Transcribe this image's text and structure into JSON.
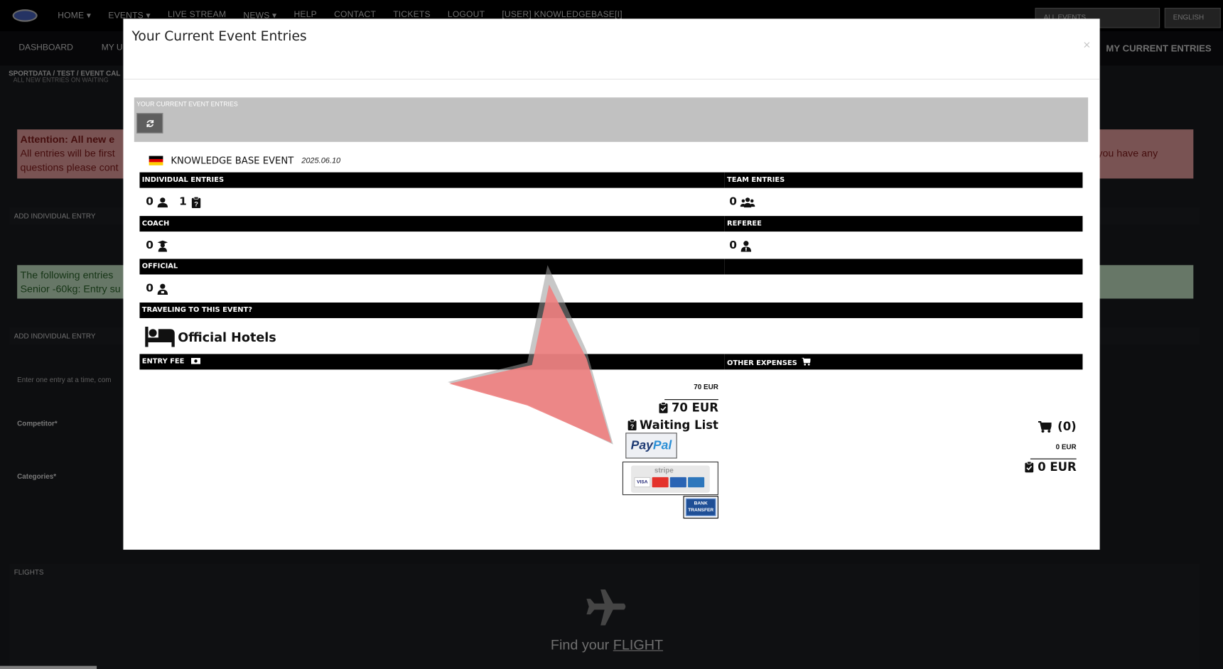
{
  "topnav": {
    "items": [
      "HOME ▾",
      "EVENTS ▾",
      "LIVE STREAM",
      "NEWS ▾",
      "HELP",
      "CONTACT",
      "TICKETS",
      "LOGOUT",
      "[USER] KNOWLEDGEBASE[I]"
    ],
    "events_select": "ALL EVENTS",
    "language_select": "ENGLISH"
  },
  "secnav": {
    "dashboard": "DASHBOARD",
    "my_u": "MY U",
    "my_current_entries": "MY CURRENT ENTRIES"
  },
  "breadcrumb": {
    "path": "SPORTDATA /  TEST /  EVENT CAL",
    "sub": "ALL NEW ENTRIES ON WAITING"
  },
  "background": {
    "alert_title": "Attention: All new e",
    "alert_text_1": "All entries will be first",
    "alert_text_2": "questions please cont",
    "alert_text_right": "you have any",
    "add_individual_1": "ADD INDIVIDUAL ENTRY",
    "green_line_1": "The following entries",
    "green_line_2": "Senior -60kg: Entry su",
    "add_individual_2": "ADD INDIVIDUAL ENTRY",
    "enter_one": "Enter one entry at a time, com",
    "competitor_label": "Competitor*",
    "categories_label": "Categories*",
    "flights_head": "FLIGHTS",
    "find_your": "Find your",
    "flight_link": "FLIGHT"
  },
  "modal": {
    "title": "Your Current Event Entries",
    "close": "×",
    "entries_box_label": "YOUR CURRENT EVENT ENTRIES",
    "event_name": "KNOWLEDGE BASE EVENT",
    "event_date": "2025.06.10",
    "sections": {
      "individual": "INDIVIDUAL ENTRIES",
      "team": "TEAM ENTRIES",
      "coach": "COACH",
      "referee": "REFEREE",
      "official": "OFFICIAL",
      "traveling": "TRAVELING TO THIS EVENT?",
      "entry_fee": "ENTRY FEE",
      "other_expenses": "OTHER EXPENSES"
    },
    "counts": {
      "individual": "0",
      "individual_waiting": "1",
      "team": "0",
      "coach": "0",
      "referee": "0",
      "official": "0"
    },
    "hotels": "Official Hotels",
    "fee": {
      "subtotal": "70 EUR",
      "total": "70 EUR",
      "waiting_list": "Waiting List"
    },
    "payment": {
      "paypal_1": "Pay",
      "paypal_2": "Pal",
      "stripe_word": "stripe",
      "cards": [
        "VISA",
        "MC",
        "Maestro",
        "AMEX"
      ],
      "bank_1": "BANK",
      "bank_2": "TRANSFER"
    },
    "other": {
      "cart": "(0)",
      "subtotal": "0 EUR",
      "total": "0 EUR"
    }
  },
  "colors": {
    "accent_bar": "#000000",
    "entries_box": "#c1c1c1",
    "pointer": "#f08080"
  }
}
